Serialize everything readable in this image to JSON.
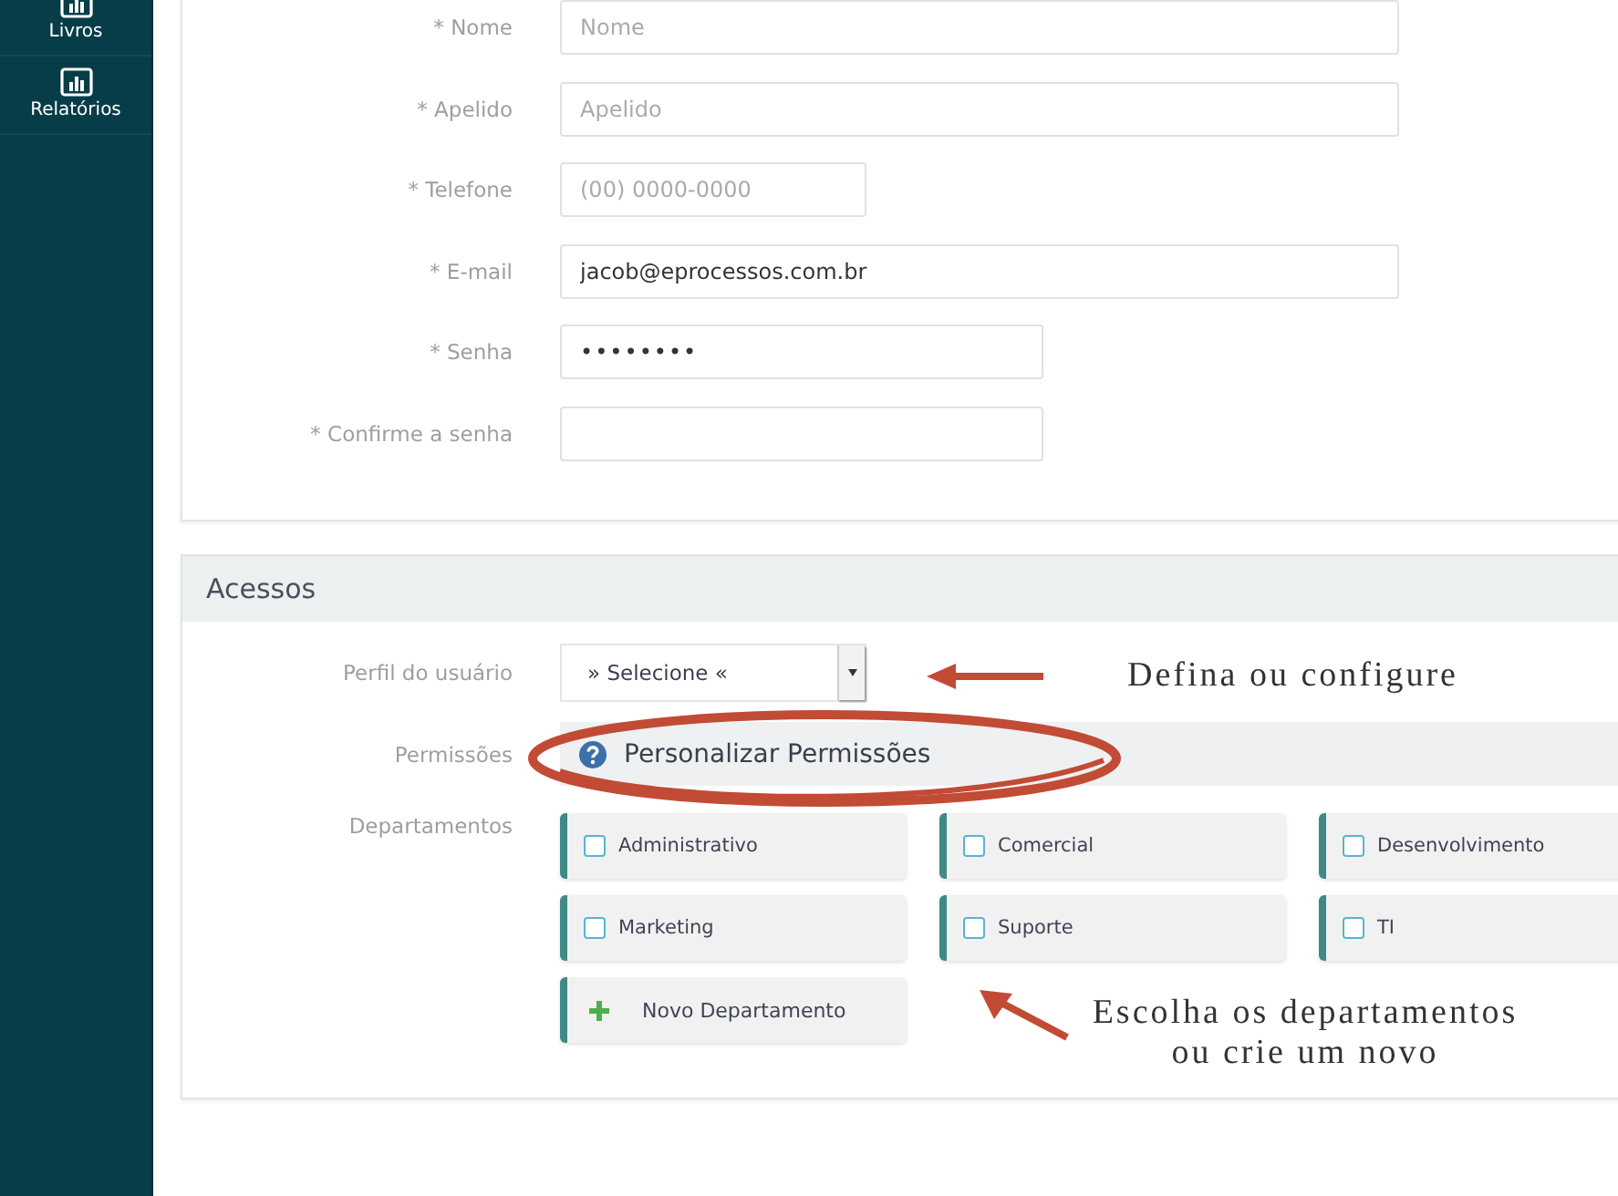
{
  "sidebar": {
    "items": [
      {
        "label": "Livros"
      },
      {
        "label": "Relatórios"
      }
    ]
  },
  "profile_form": {
    "fields": [
      {
        "label": "* Nome",
        "placeholder": "Nome",
        "kind": "text"
      },
      {
        "label": "* Apelido",
        "placeholder": "Apelido",
        "kind": "text"
      },
      {
        "label": "* Telefone",
        "placeholder": "(00) 0000-0000",
        "kind": "phone"
      },
      {
        "label": "* E-mail",
        "value": "jacob@eprocessos.com.br",
        "kind": "email"
      },
      {
        "label": "* Senha",
        "value": "••••••••",
        "kind": "password"
      },
      {
        "label": "* Confirme a senha",
        "kind": "password"
      }
    ]
  },
  "access": {
    "title": "Acessos",
    "profile": {
      "label": "Perfil do usuário",
      "value": "» Selecione «"
    },
    "permissions": {
      "label": "Permissões",
      "button": "Personalizar Permissões"
    },
    "departments": {
      "label": "Departamentos",
      "items": [
        {
          "name": "Administrativo",
          "checked": false
        },
        {
          "name": "Comercial",
          "checked": false
        },
        {
          "name": "Desenvolvimento",
          "checked": false
        },
        {
          "name": "Marketing",
          "checked": false
        },
        {
          "name": "Suporte",
          "checked": false
        },
        {
          "name": "TI",
          "checked": false
        }
      ],
      "new_button": "Novo Departamento"
    }
  },
  "annotations": [
    {
      "text": "Defina ou configure"
    },
    {
      "text": "Escolha os departamentos ou crie um novo"
    }
  ]
}
